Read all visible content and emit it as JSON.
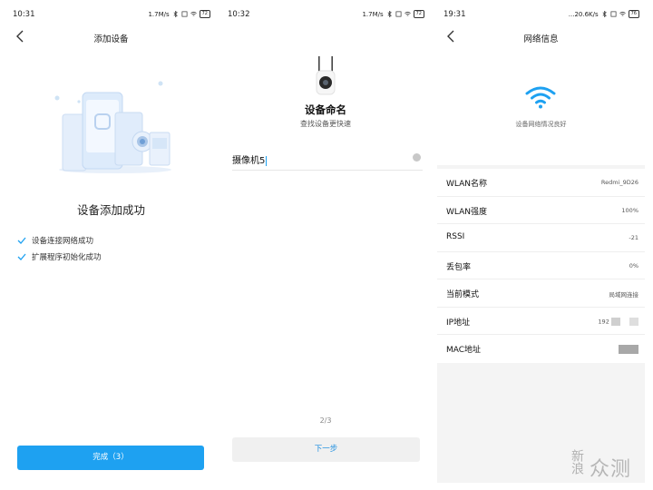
{
  "panel1": {
    "status": {
      "time": "10:31",
      "speed": "1.7M/s",
      "battery": "72"
    },
    "title": "添加设备",
    "heading": "设备添加成功",
    "checks": [
      "设备连接网络成功",
      "扩展程序初始化成功"
    ],
    "done_label": "完成（3）",
    "accent": "#1ea1f1"
  },
  "panel2": {
    "status": {
      "time": "10:32",
      "speed": "1.7M/s",
      "battery": "72"
    },
    "title": "设备命名",
    "subtitle": "查找设备更快速",
    "name_value": "摄像机5",
    "pager": "2/3",
    "next_label": "下一步"
  },
  "panel3": {
    "status": {
      "time": "19:31",
      "speed": "...20.6K/s",
      "battery": "76"
    },
    "title": "网络信息",
    "signal_text": "设备网络情况良好",
    "rows": [
      {
        "key": "WLAN名称",
        "value": "Redmi_9D26"
      },
      {
        "key": "WLAN强度",
        "value": "100%"
      },
      {
        "key": "RSSI",
        "value": "-21"
      },
      {
        "key": "丢包率",
        "value": "0%"
      },
      {
        "key": "当前模式",
        "value": "局域网连接"
      },
      {
        "key": "IP地址",
        "value": "192"
      },
      {
        "key": "MAC地址",
        "value": ""
      }
    ]
  },
  "watermark": {
    "zh": "新浪",
    "en": "众测"
  }
}
